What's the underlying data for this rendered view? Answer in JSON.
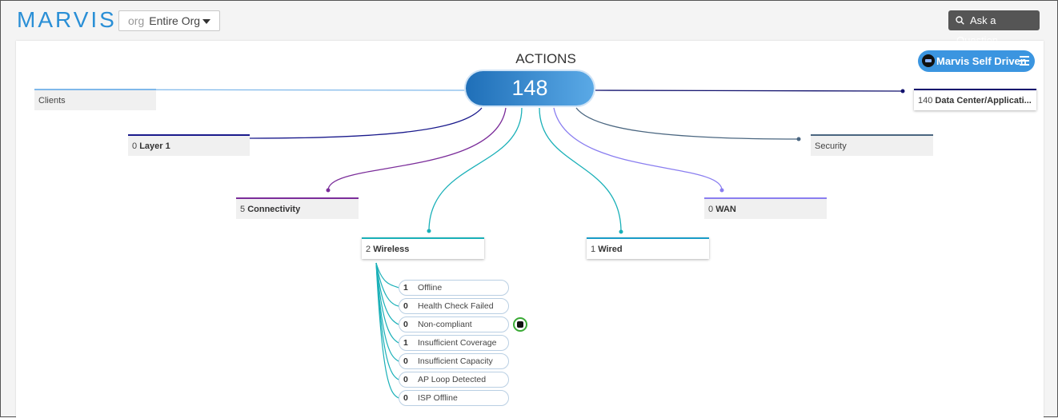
{
  "app": {
    "logo": "MARVIS"
  },
  "org_select": {
    "prefix": "org",
    "value": "Entire Org"
  },
  "ask_button": {
    "label": "Ask a Question",
    "icon": "search-icon"
  },
  "self_driven": {
    "label": "Marvis Self Driven",
    "icon": "robot-icon",
    "menu_icon": "menu-icon"
  },
  "actions": {
    "title": "ACTIONS",
    "total": "148"
  },
  "categories": {
    "clients": {
      "label": "Clients"
    },
    "layer1": {
      "count": "0",
      "label": "Layer 1"
    },
    "connectivity": {
      "count": "5",
      "label": "Connectivity"
    },
    "wireless": {
      "count": "2",
      "label": "Wireless"
    },
    "wired": {
      "count": "1",
      "label": "Wired"
    },
    "wan": {
      "count": "0",
      "label": "WAN"
    },
    "security": {
      "label": "Security"
    },
    "datacenter": {
      "count": "140",
      "label": "Data Center/Applicati..."
    }
  },
  "wireless_items": [
    {
      "count": "1",
      "label": "Offline"
    },
    {
      "count": "0",
      "label": "Health Check Failed"
    },
    {
      "count": "0",
      "label": "Non-compliant"
    },
    {
      "count": "1",
      "label": "Insufficient Coverage"
    },
    {
      "count": "0",
      "label": "Insufficient Capacity"
    },
    {
      "count": "0",
      "label": "AP Loop Detected"
    },
    {
      "count": "0",
      "label": "ISP Offline"
    }
  ],
  "colors": {
    "accent": "#2a8fd6",
    "clients": "#7fb8ea",
    "layer1": "#1a1a8c",
    "connectivity": "#7b2d9a",
    "wireless": "#1ab0b8",
    "wired": "#1a9cc8",
    "wan": "#8a7ef0",
    "security": "#4a6680",
    "datacenter": "#12126e"
  }
}
